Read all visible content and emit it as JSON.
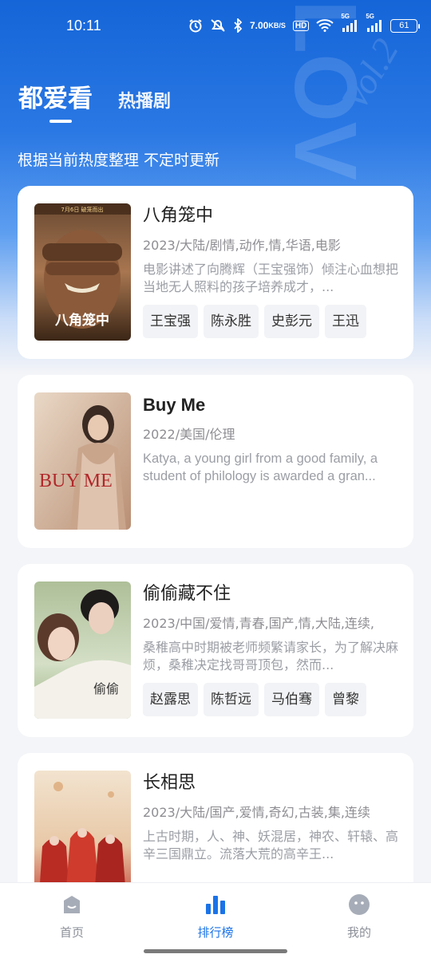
{
  "status_bar": {
    "time": "10:11",
    "net_speed_value": "7.00",
    "net_speed_unit": "KB/S",
    "hd": "HD",
    "signal1": "5G",
    "signal2": "5G",
    "battery": "61"
  },
  "header": {
    "tabs": [
      {
        "label": "都爱看",
        "active": true
      },
      {
        "label": "热播剧",
        "active": false
      }
    ],
    "subtitle": "根据当前热度整理 不定时更新",
    "decoration_text_1": "LOVE",
    "decoration_text_2": "Vol.2"
  },
  "items": [
    {
      "title": "八角笼中",
      "meta": "2023/大陆/剧情,动作,情,华语,电影",
      "desc": "电影讲述了向腾辉（王宝强饰）倾注心血想把当地无人照料的孩子培养成才，...",
      "tags": [
        "王宝强",
        "陈永胜",
        "史彭元",
        "王迅"
      ],
      "poster_text_top": "7月6日 破笼而出",
      "poster_text": "八角笼中"
    },
    {
      "title": "Buy Me",
      "meta": "2022/美国/伦理",
      "desc": "Katya, a young girl from a good family, a student of philology is awarded a gran...",
      "tags": [],
      "poster_text": "BUY ME"
    },
    {
      "title": "偷偷藏不住",
      "meta": "2023/中国/爱情,青春,国产,情,大陆,连续,",
      "desc": "桑稚高中时期被老师频繁请家长，为了解决麻烦，桑稚决定找哥哥顶包，然而...",
      "tags": [
        "赵露思",
        "陈哲远",
        "马伯骞",
        "曾黎"
      ],
      "poster_text": "偷偷"
    },
    {
      "title": "长相思",
      "meta": "2023/大陆/国产,爱情,奇幻,古装,集,连续",
      "desc": "上古时期，人、神、妖混居，神农、轩辕、高辛三国鼎立。流落大荒的高辛王...",
      "tags": []
    }
  ],
  "bottom_nav": [
    {
      "label": "首页",
      "icon": "home-icon",
      "active": false
    },
    {
      "label": "排行榜",
      "icon": "ranking-icon",
      "active": true
    },
    {
      "label": "我的",
      "icon": "profile-icon",
      "active": false
    }
  ],
  "colors": {
    "accent": "#1a73e8",
    "header_blue": "#1565d8"
  }
}
